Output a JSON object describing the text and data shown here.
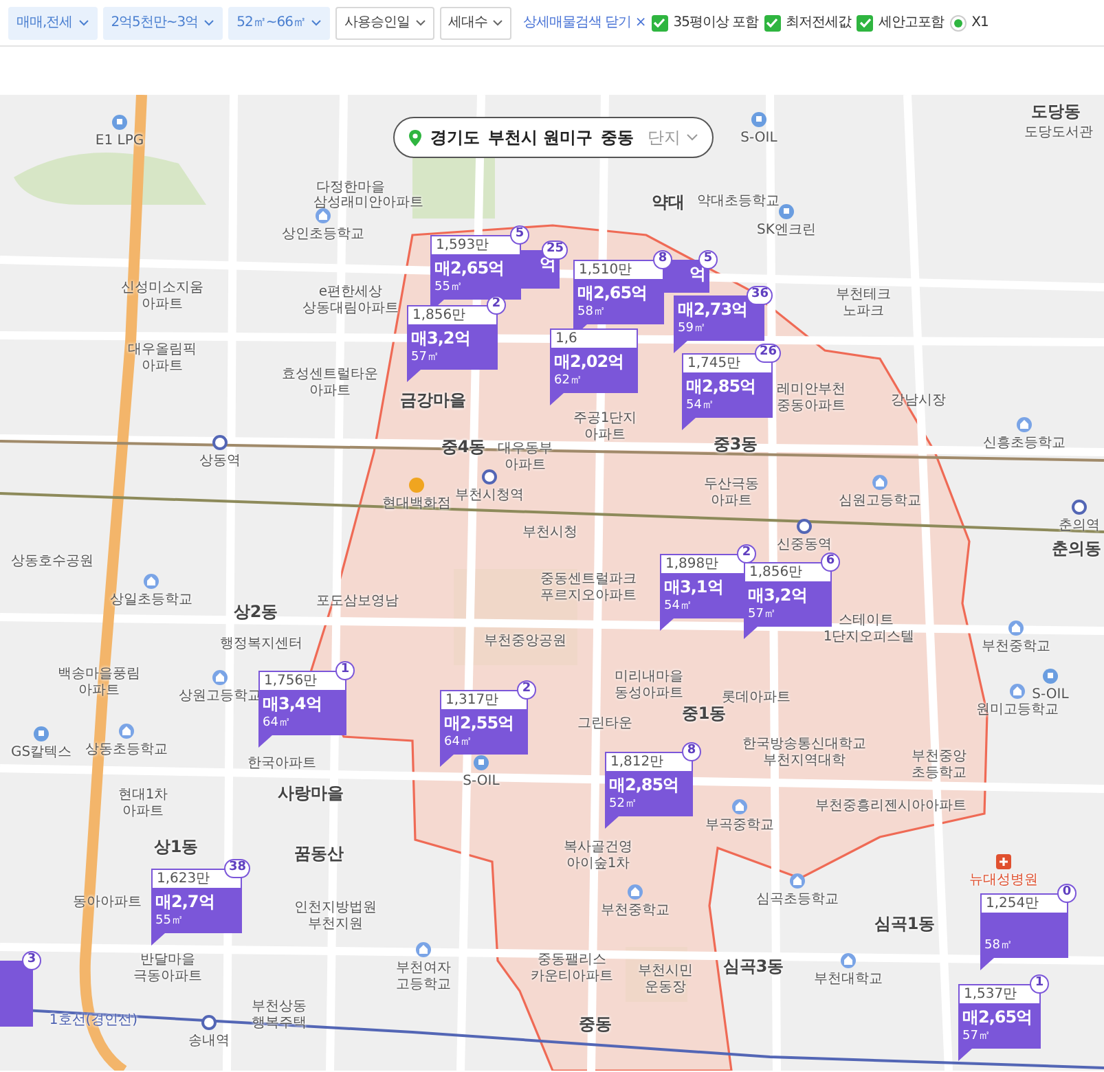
{
  "filters": [
    {
      "label": "매매,전세",
      "active": true
    },
    {
      "label": "2억5천만~3억",
      "active": true
    },
    {
      "label": "52㎡~66㎡",
      "active": true
    },
    {
      "label": "사용승인일",
      "active": false
    },
    {
      "label": "세대수",
      "active": false
    }
  ],
  "detail_toggle": {
    "label": "상세매물검색 닫기",
    "close": "×"
  },
  "options": [
    {
      "label": "35평이상 포함",
      "checked": true
    },
    {
      "label": "최저전세값",
      "checked": true
    },
    {
      "label": "세안고포함",
      "checked": true
    }
  ],
  "scale": {
    "label": "X1",
    "selected": true
  },
  "breadcrumb": {
    "levels": [
      "경기도",
      "부천시 원미구",
      "중동"
    ],
    "placeholder": "단지"
  },
  "map": {
    "labels": [
      {
        "text": "E1 LPG",
        "kind": "poi"
      },
      {
        "text": "S-OIL",
        "kind": "poi"
      },
      {
        "text": "도당동",
        "kind": "district"
      },
      {
        "text": "도당도서관",
        "kind": "place"
      },
      {
        "text": "약대",
        "kind": "district"
      },
      {
        "text": "약대초등학교",
        "kind": "place"
      },
      {
        "text": "SK엔크린",
        "kind": "poi"
      },
      {
        "text": "다정한마을",
        "kind": "place"
      },
      {
        "text": "삼성래미안아파트",
        "kind": "place"
      },
      {
        "text": "상인초등학교",
        "kind": "school"
      },
      {
        "text": "신성미소지움",
        "kind": "place"
      },
      {
        "text": "아파트",
        "kind": "place"
      },
      {
        "text": "e편한세상",
        "kind": "place"
      },
      {
        "text": "상동대림아파트",
        "kind": "place"
      },
      {
        "text": "부천테크",
        "kind": "place"
      },
      {
        "text": "노파크",
        "kind": "place"
      },
      {
        "text": "대우올림픽",
        "kind": "place"
      },
      {
        "text": "아파트",
        "kind": "place"
      },
      {
        "text": "효성센트럴타운",
        "kind": "place"
      },
      {
        "text": "아파트",
        "kind": "place"
      },
      {
        "text": "금강마을",
        "kind": "district"
      },
      {
        "text": "레미안부천",
        "kind": "place"
      },
      {
        "text": "중동아파트",
        "kind": "place"
      },
      {
        "text": "강남시장",
        "kind": "place"
      },
      {
        "text": "주공1단지",
        "kind": "place"
      },
      {
        "text": "아파트",
        "kind": "place"
      },
      {
        "text": "중4동",
        "kind": "district"
      },
      {
        "text": "대우동부",
        "kind": "place"
      },
      {
        "text": "중3동",
        "kind": "district"
      },
      {
        "text": "신흥초등학교",
        "kind": "school"
      },
      {
        "text": "아파트",
        "kind": "place"
      },
      {
        "text": "상동역",
        "kind": "station"
      },
      {
        "text": "부천시청역",
        "kind": "station"
      },
      {
        "text": "현대백화점",
        "kind": "mall"
      },
      {
        "text": "두산극동",
        "kind": "place"
      },
      {
        "text": "아파트",
        "kind": "place"
      },
      {
        "text": "심원고등학교",
        "kind": "school"
      },
      {
        "text": "춘의역",
        "kind": "station"
      },
      {
        "text": "부천시청",
        "kind": "place"
      },
      {
        "text": "신중동역",
        "kind": "station"
      },
      {
        "text": "춘의동",
        "kind": "district"
      },
      {
        "text": "상동호수공원",
        "kind": "place"
      },
      {
        "text": "상일초등학교",
        "kind": "school"
      },
      {
        "text": "포도삼보영남",
        "kind": "place"
      },
      {
        "text": "중동센트럴파크",
        "kind": "place"
      },
      {
        "text": "푸르지오아파트",
        "kind": "place"
      },
      {
        "text": "상2동",
        "kind": "district"
      },
      {
        "text": "스테이트",
        "kind": "place"
      },
      {
        "text": "행정복지센터",
        "kind": "place"
      },
      {
        "text": "1단지오피스텔",
        "kind": "place"
      },
      {
        "text": "부천중앙공원",
        "kind": "place"
      },
      {
        "text": "부천중학교",
        "kind": "school"
      },
      {
        "text": "백송마을풍림",
        "kind": "place"
      },
      {
        "text": "아파트",
        "kind": "place"
      },
      {
        "text": "미리내마을",
        "kind": "place"
      },
      {
        "text": "동성아파트",
        "kind": "place"
      },
      {
        "text": "중1동",
        "kind": "district"
      },
      {
        "text": "S-OIL",
        "kind": "poi"
      },
      {
        "text": "원미고등학교",
        "kind": "school"
      },
      {
        "text": "상원고등학교",
        "kind": "school"
      },
      {
        "text": "롯데아파트",
        "kind": "place"
      },
      {
        "text": "그린타운",
        "kind": "place"
      },
      {
        "text": "한국방송통신대학교",
        "kind": "place"
      },
      {
        "text": "GS칼텍스",
        "kind": "poi"
      },
      {
        "text": "상동초등학교",
        "kind": "school"
      },
      {
        "text": "한국아파트",
        "kind": "place"
      },
      {
        "text": "부천지역대학",
        "kind": "place"
      },
      {
        "text": "부천중앙",
        "kind": "place"
      },
      {
        "text": "초등학교",
        "kind": "place"
      },
      {
        "text": "S-OIL",
        "kind": "poi"
      },
      {
        "text": "현대1차",
        "kind": "place"
      },
      {
        "text": "사랑마을",
        "kind": "district"
      },
      {
        "text": "부천중흥리젠시아아파트",
        "kind": "place"
      },
      {
        "text": "아파트",
        "kind": "place"
      },
      {
        "text": "부곡중학교",
        "kind": "school"
      },
      {
        "text": "복사골건영",
        "kind": "place"
      },
      {
        "text": "꿈동산",
        "kind": "district"
      },
      {
        "text": "상1동",
        "kind": "district"
      },
      {
        "text": "아이숲1차",
        "kind": "place"
      },
      {
        "text": "뉴대성병원",
        "kind": "hospital"
      },
      {
        "text": "동아아파트",
        "kind": "place"
      },
      {
        "text": "심곡초등학교",
        "kind": "school"
      },
      {
        "text": "인천지방법원",
        "kind": "place"
      },
      {
        "text": "부천중학교",
        "kind": "school"
      },
      {
        "text": "심곡1동",
        "kind": "district"
      },
      {
        "text": "부천지원",
        "kind": "place"
      },
      {
        "text": "반달마을",
        "kind": "place"
      },
      {
        "text": "중동팰리스",
        "kind": "place"
      },
      {
        "text": "부천여자",
        "kind": "school"
      },
      {
        "text": "부천시민",
        "kind": "place"
      },
      {
        "text": "심곡3동",
        "kind": "district"
      },
      {
        "text": "극동아파트",
        "kind": "place"
      },
      {
        "text": "고등학교",
        "kind": "place"
      },
      {
        "text": "카운티아파트",
        "kind": "place"
      },
      {
        "text": "운동장",
        "kind": "place"
      },
      {
        "text": "부천대학교",
        "kind": "school"
      },
      {
        "text": "부천상동",
        "kind": "place"
      },
      {
        "text": "1호선(경인선)",
        "kind": "line"
      },
      {
        "text": "행복주택",
        "kind": "place"
      },
      {
        "text": "중동",
        "kind": "district"
      },
      {
        "text": "송내역",
        "kind": "station"
      }
    ],
    "markers": [
      {
        "kind": "full",
        "price": "1,593만",
        "main": "매2,65억",
        "area": "55㎡",
        "count": "5"
      },
      {
        "kind": "partial",
        "main": "억",
        "count": "25"
      },
      {
        "kind": "full",
        "price": "1,510만",
        "main": "매2,65억",
        "area": "58㎡",
        "count": "8"
      },
      {
        "kind": "partial",
        "main": "억",
        "count": "5"
      },
      {
        "kind": "full",
        "price": "1,856만",
        "main": "매3,2억",
        "area": "57㎡",
        "count": "2"
      },
      {
        "kind": "full",
        "price": "1,6",
        "main": "매2,02억",
        "area": "62㎡"
      },
      {
        "kind": "full",
        "main": "매2,73억",
        "area": "59㎡",
        "count": "36"
      },
      {
        "kind": "full",
        "price": "1,745만",
        "main": "매2,85억",
        "area": "54㎡",
        "count": "26"
      },
      {
        "kind": "full",
        "price": "1,898만",
        "main": "매3,1억",
        "area": "54㎡",
        "count": "2"
      },
      {
        "kind": "full",
        "price": "1,856만",
        "main": "매3,2억",
        "area": "57㎡",
        "count": "6"
      },
      {
        "kind": "full",
        "price": "1,756만",
        "main": "매3,4억",
        "area": "64㎡",
        "count": "1"
      },
      {
        "kind": "full",
        "price": "1,317만",
        "main": "매2,55억",
        "area": "64㎡",
        "count": "2"
      },
      {
        "kind": "full",
        "price": "1,812만",
        "main": "매2,85억",
        "area": "52㎡",
        "count": "8"
      },
      {
        "kind": "full",
        "price": "1,623만",
        "main": "매2,7억",
        "area": "55㎡",
        "count": "38"
      },
      {
        "kind": "full",
        "price": "1,254만",
        "area": "58㎡",
        "count": "0"
      },
      {
        "kind": "partial",
        "count": "3"
      },
      {
        "kind": "full",
        "price": "1,537만",
        "main": "매2,65억",
        "area": "57㎡",
        "count": "1"
      }
    ]
  }
}
